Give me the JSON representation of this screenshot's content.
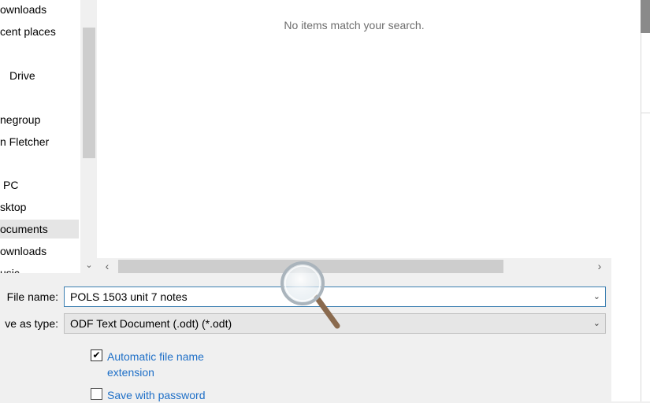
{
  "nav": {
    "items": [
      {
        "label": "ownloads"
      },
      {
        "label": "cent places"
      },
      {
        "label": "Drive"
      },
      {
        "label": "negroup"
      },
      {
        "label": "n Fletcher"
      },
      {
        "label": "PC"
      },
      {
        "label": "sktop"
      },
      {
        "label": "ocuments",
        "selected": true
      },
      {
        "label": "ownloads"
      },
      {
        "label": "usic"
      }
    ]
  },
  "filelist": {
    "empty_message": "No items match your search."
  },
  "form": {
    "file_name_label": "File name:",
    "file_name_value": "POLS 1503 unit 7 notes",
    "save_as_type_label": "ve as type:",
    "save_as_type_value": "ODF Text Document (.odt) (*.odt)"
  },
  "options": {
    "auto_extension_line1": "Automatic file name",
    "auto_extension_line2": "extension",
    "auto_extension_checked": true,
    "save_with_password_label": "Save with password",
    "save_with_password_checked": false
  },
  "icons": {
    "chevron": "chevron-down-icon",
    "scroll_left": "chevron-left-icon",
    "scroll_right": "chevron-right-icon",
    "magnifier": "magnifier-icon"
  },
  "colors": {
    "accent_link": "#1e6fc7",
    "focus_border": "#3c7fb1",
    "selection": "#e5e5e5"
  }
}
